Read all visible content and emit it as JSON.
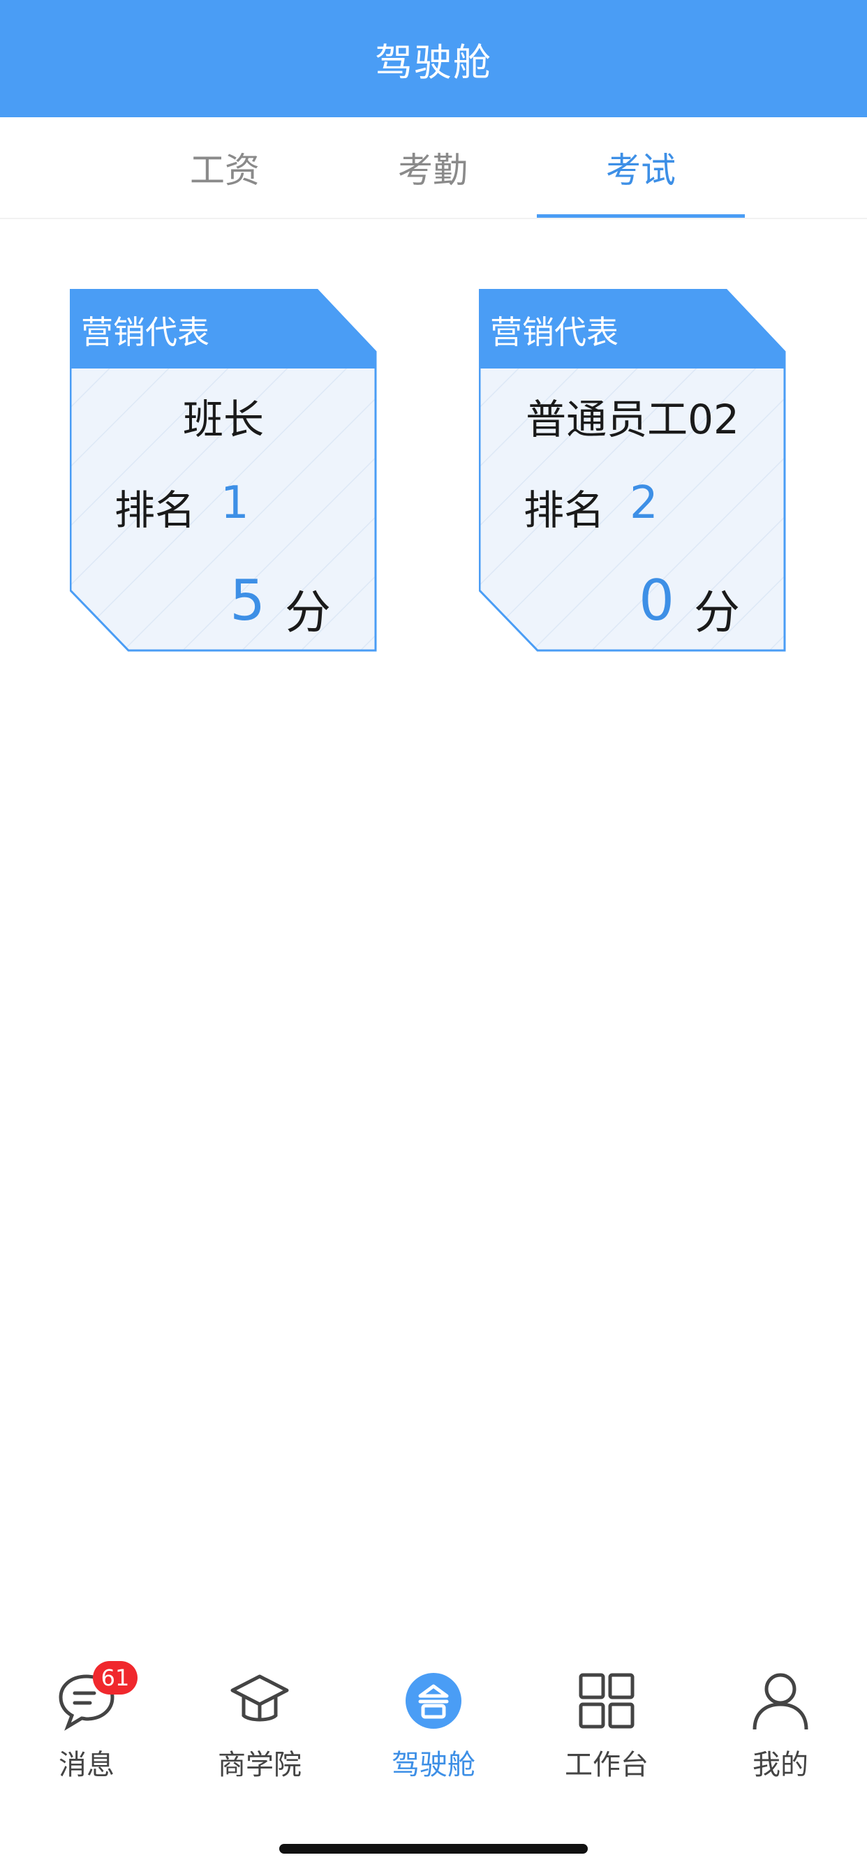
{
  "header": {
    "title": "驾驶舱"
  },
  "tabs": [
    {
      "label": "工资",
      "active": false
    },
    {
      "label": "考勤",
      "active": false
    },
    {
      "label": "考试",
      "active": true
    }
  ],
  "cards": [
    {
      "dept": "营销代表",
      "name": "班长",
      "rank_label": "排名",
      "rank": "1",
      "score": "5",
      "score_unit": "分"
    },
    {
      "dept": "营销代表",
      "name": "普通员工02",
      "rank_label": "排名",
      "rank": "2",
      "score": "0",
      "score_unit": "分"
    }
  ],
  "nav": [
    {
      "label": "消息",
      "icon": "chat-bubble-icon",
      "badge": "61"
    },
    {
      "label": "商学院",
      "icon": "graduation-cap-icon"
    },
    {
      "label": "驾驶舱",
      "icon": "cockpit-icon",
      "active": true
    },
    {
      "label": "工作台",
      "icon": "grid-icon"
    },
    {
      "label": "我的",
      "icon": "person-icon"
    }
  ],
  "colors": {
    "primary": "#4a9df5",
    "accent_text": "#3d8fe6",
    "card_bg": "#eef4fc",
    "badge": "#f0282d"
  }
}
